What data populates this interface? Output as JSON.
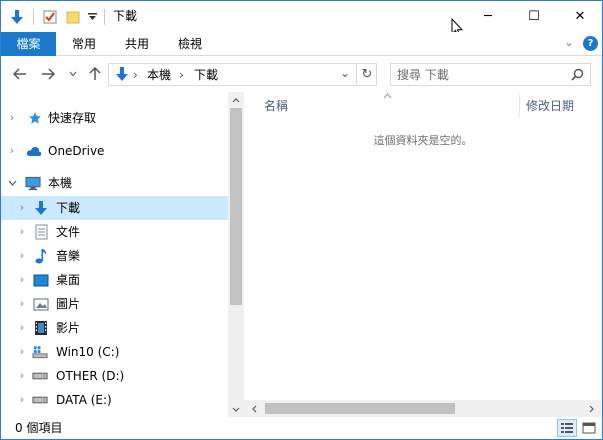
{
  "window": {
    "title": "下載",
    "controls": {
      "minimize": "─",
      "maximize": "☐",
      "close": "✕"
    }
  },
  "quick_access": {
    "icons": [
      "download-arrow-icon",
      "properties-checkbox-icon",
      "folder-icon",
      "customize-dropdown-icon"
    ]
  },
  "ribbon": {
    "tabs": [
      {
        "label": "檔案",
        "active": true
      },
      {
        "label": "常用",
        "active": false
      },
      {
        "label": "共用",
        "active": false
      },
      {
        "label": "檢視",
        "active": false
      }
    ],
    "expand_glyph": "⌄",
    "help_glyph": "?"
  },
  "address": {
    "path": [
      "本機",
      "下載"
    ],
    "separator": "›",
    "dropdown_glyph": "⌄",
    "refresh_glyph": "↻"
  },
  "search": {
    "placeholder": "搜尋 下載"
  },
  "nav_tree": [
    {
      "label": "快速存取",
      "icon": "star-icon"
    },
    {
      "label": "OneDrive",
      "icon": "cloud-icon"
    },
    {
      "label": "本機",
      "icon": "computer-icon",
      "expanded": true
    },
    {
      "label": "下載",
      "icon": "download-icon",
      "selected": true
    },
    {
      "label": "文件",
      "icon": "document-icon"
    },
    {
      "label": "音樂",
      "icon": "music-icon"
    },
    {
      "label": "桌面",
      "icon": "desktop-icon"
    },
    {
      "label": "圖片",
      "icon": "pictures-icon"
    },
    {
      "label": "影片",
      "icon": "video-icon"
    },
    {
      "label": "Win10 (C:)",
      "icon": "system-drive-icon"
    },
    {
      "label": "OTHER (D:)",
      "icon": "drive-icon"
    },
    {
      "label": "DATA (E:)",
      "icon": "drive-icon"
    }
  ],
  "content": {
    "columns": {
      "name": "名稱",
      "modified": "修改日期"
    },
    "empty_message": "這個資料夾是空的。"
  },
  "status": {
    "item_count": "0 個項目"
  },
  "colors": {
    "accent": "#1979ca",
    "selection": "#cce8ff",
    "border": "#2b7fd4"
  }
}
